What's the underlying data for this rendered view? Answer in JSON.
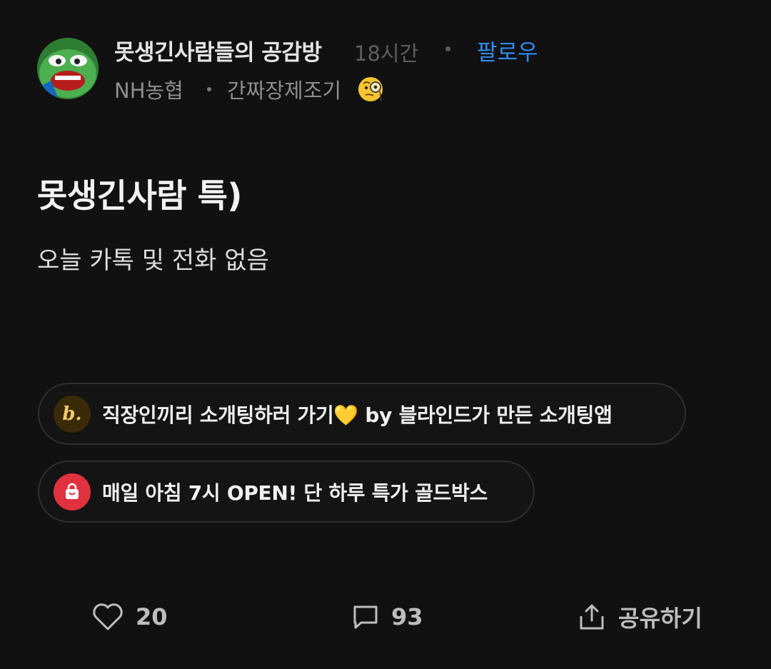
{
  "header": {
    "community_name": "못생긴사람들의 공감방",
    "time_ago": "18시간",
    "follow_label": "팔로우",
    "company": "NH농협",
    "nickname": "간짜장제조기",
    "nickname_emoji": "face-with-monocle-emoji"
  },
  "post": {
    "title": "못생긴사람 특)",
    "body": "오늘 카톡 및 전화 없음"
  },
  "ads": [
    {
      "text": "직장인끼리 소개팅하러 가기💛 by 블라인드가 만든 소개팅앱",
      "icon": "blind-logo-icon",
      "icon_glyph": "b."
    },
    {
      "text": "매일 아침 7시 OPEN! 단 하루 특가 골드박스",
      "icon": "shopping-bag-icon"
    }
  ],
  "actions": {
    "likes": "20",
    "comments": "93",
    "share_label": "공유하기"
  },
  "colors": {
    "background": "#111111",
    "follow_blue": "#2f8cf0",
    "shop_red": "#e0313f",
    "blind_gold": "#e8a317"
  }
}
